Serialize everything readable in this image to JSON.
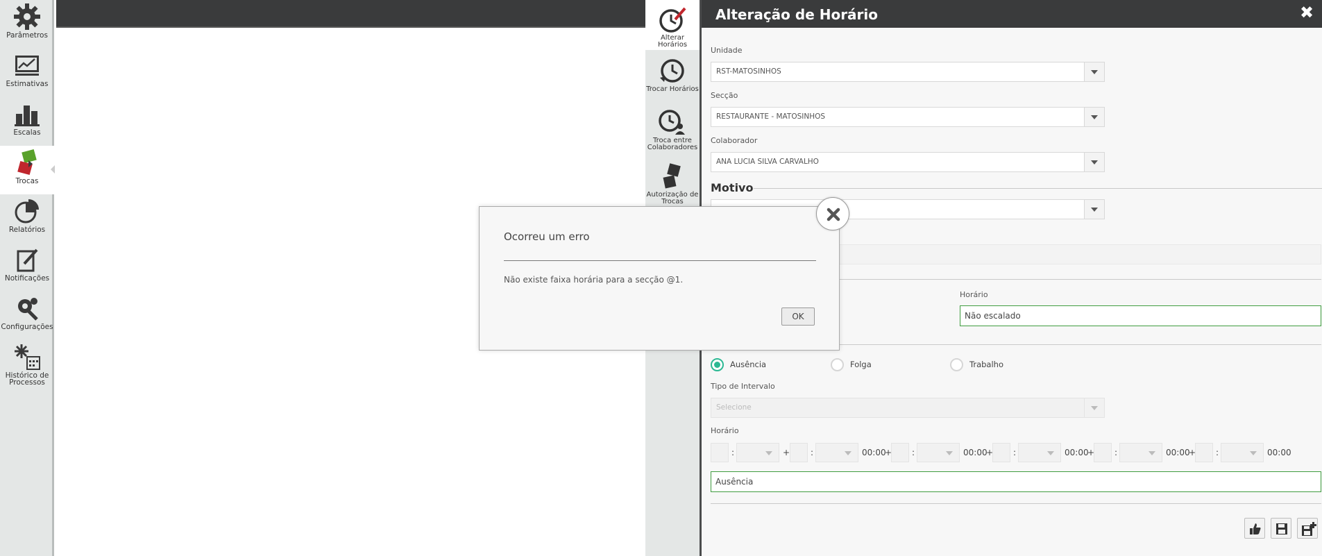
{
  "sidebar": {
    "items": [
      {
        "label": "Parâmetros",
        "icon": "gear-icon"
      },
      {
        "label": "Estimativas",
        "icon": "chart-board-icon"
      },
      {
        "label": "Escalas",
        "icon": "bar-chart-icon"
      },
      {
        "label": "Trocas",
        "icon": "swap-cards-icon"
      },
      {
        "label": "Relatórios",
        "icon": "pie-chart-icon"
      },
      {
        "label": "Notificações",
        "icon": "note-pen-icon"
      },
      {
        "label": "Configurações",
        "icon": "gear-wrench-icon"
      },
      {
        "label_line1": "Histórico de",
        "label_line2": "Processos",
        "icon": "calendar-history-icon"
      }
    ]
  },
  "tabs": {
    "items": [
      {
        "label": "Alterar Horários",
        "icon": "clock-edit-icon"
      },
      {
        "label": "Trocar Horários",
        "icon": "clock-swap-icon"
      },
      {
        "label_line1": "Troca entre",
        "label_line2": "Colaboradores",
        "icon": "clock-users-icon"
      },
      {
        "label_line1": "Autorização de",
        "label_line2": "Trocas",
        "icon": "cards-approve-icon"
      }
    ]
  },
  "panel": {
    "title": "Alteração de Horário",
    "unidade_label": "Unidade",
    "unidade_value": "RST-MATOSINHOS",
    "seccao_label": "Secção",
    "seccao_value": "RESTAURANTE - MATOSINHOS",
    "colaborador_label": "Colaborador",
    "colaborador_value": "ANA LUCIA SILVA CARVALHO",
    "motivo_title": "Motivo",
    "horario_label": "Horário",
    "horario_value": "Não escalado",
    "radio_ausencia": "Ausência",
    "radio_folga": "Folga",
    "radio_trabalho": "Trabalho",
    "tipo_intervalo_label": "Tipo de Intervalo",
    "tipo_intervalo_placeholder": "Selecione",
    "horario2_label": "Horário",
    "time_colon": ":",
    "time_plus": "+",
    "time_total": "00:00",
    "ausencia_value": "Ausência"
  },
  "modal": {
    "title": "Ocorreu um erro",
    "message": "Não existe faixa horária para a secção @1.",
    "ok_label": "OK"
  },
  "colors": {
    "accent_green": "#3f9c3f",
    "radio_teal": "#2cb893",
    "header_dark": "#3a3b3c"
  }
}
